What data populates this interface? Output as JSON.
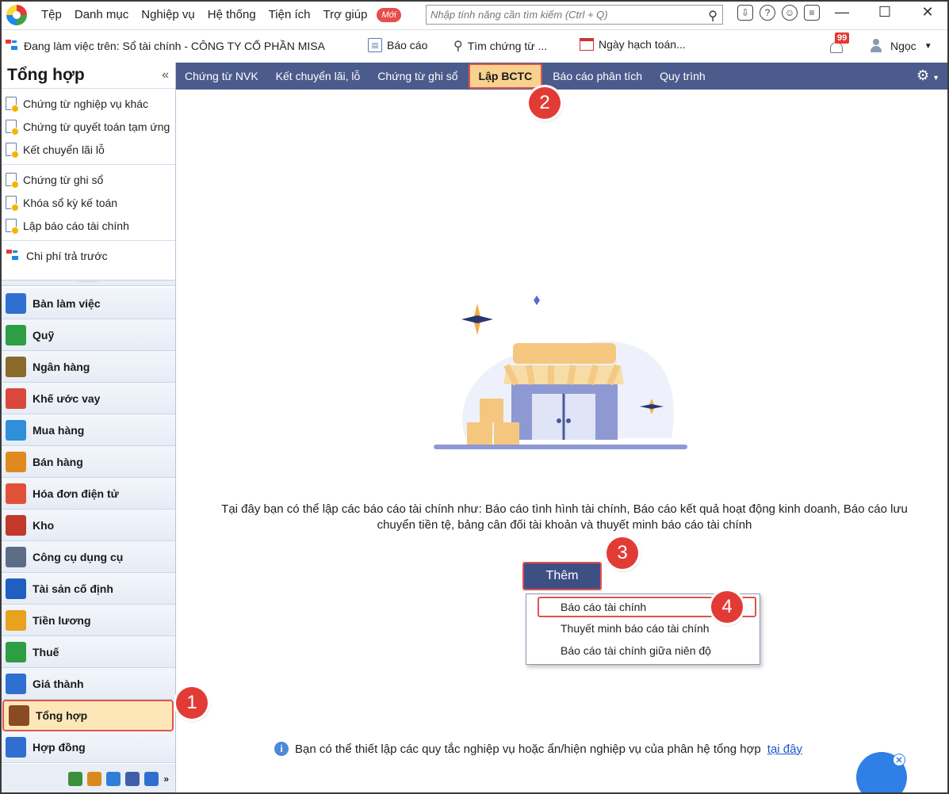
{
  "menubar": {
    "items": [
      "Tệp",
      "Danh mục",
      "Nghiệp vụ",
      "Hệ thống",
      "Tiện ích",
      "Trợ giúp"
    ],
    "new_badge": "Mới",
    "search_placeholder": "Nhập tính năng cần tìm kiếm (Ctrl + Q)"
  },
  "infobar": {
    "working_on": "Đang làm việc trên: Sổ tài chính - CÔNG TY CỔ PHẦN MISA",
    "report_label": "Báo cáo",
    "find_label": "Tìm chứng từ ...",
    "date_label": "Ngày hạch toán...",
    "notification_count": "99",
    "user_name": "Ngọc"
  },
  "leftpanel": {
    "title": "Tổng hợp",
    "groups": [
      [
        "Chứng từ nghiệp vụ khác",
        "Chứng từ quyết toán tạm ứng",
        "Kết chuyển lãi lỗ"
      ],
      [
        "Chứng từ ghi sổ",
        "Khóa sổ kỳ kế toán",
        "Lập báo cáo tài chính"
      ],
      [
        "Chi phí trả trước"
      ]
    ],
    "modules": [
      {
        "label": "Bàn làm việc",
        "color": "#2f6fd0"
      },
      {
        "label": "Quỹ",
        "color": "#2e9e45"
      },
      {
        "label": "Ngân hàng",
        "color": "#8a6a2a"
      },
      {
        "label": "Khế ước vay",
        "color": "#d9483b"
      },
      {
        "label": "Mua hàng",
        "color": "#2f8fd8"
      },
      {
        "label": "Bán hàng",
        "color": "#e08a1e"
      },
      {
        "label": "Hóa đơn điện tử",
        "color": "#e0533a"
      },
      {
        "label": "Kho",
        "color": "#c0392b"
      },
      {
        "label": "Công cụ dụng cụ",
        "color": "#5d6d86"
      },
      {
        "label": "Tài sản cố định",
        "color": "#1f5fbf"
      },
      {
        "label": "Tiền lương",
        "color": "#e8a21e"
      },
      {
        "label": "Thuế",
        "color": "#2e9e45"
      },
      {
        "label": "Giá thành",
        "color": "#2f6fd0"
      },
      {
        "label": "Tổng hợp",
        "color": "#8a4b22"
      },
      {
        "label": "Hợp đồng",
        "color": "#2f6fd0"
      }
    ]
  },
  "tabs": [
    "Chứng từ NVK",
    "Kết chuyển lãi, lỗ",
    "Chứng từ ghi sổ",
    "Lập BCTC",
    "Báo cáo phân tích",
    "Quy trình"
  ],
  "main": {
    "description": "Tại đây bạn có thể lập các báo cáo tài chính như: Báo cáo tình hình tài chính, Báo cáo kết quả hoạt động kinh doanh, Báo cáo lưu chuyển tiền tệ, bảng cân đối tài khoản và thuyết minh báo cáo tài chính",
    "add_button": "Thêm",
    "dropdown": [
      "Báo cáo tài chính",
      "Thuyết minh báo cáo tài chính",
      "Báo cáo tài chính giữa niên độ"
    ],
    "hint_text": "Bạn có thể thiết lập các quy tắc nghiệp vụ hoặc ẩn/hiện nghiệp vụ của phân hệ tổng hợp",
    "hint_link": "tại đây"
  },
  "steps": [
    "1",
    "2",
    "3",
    "4"
  ]
}
